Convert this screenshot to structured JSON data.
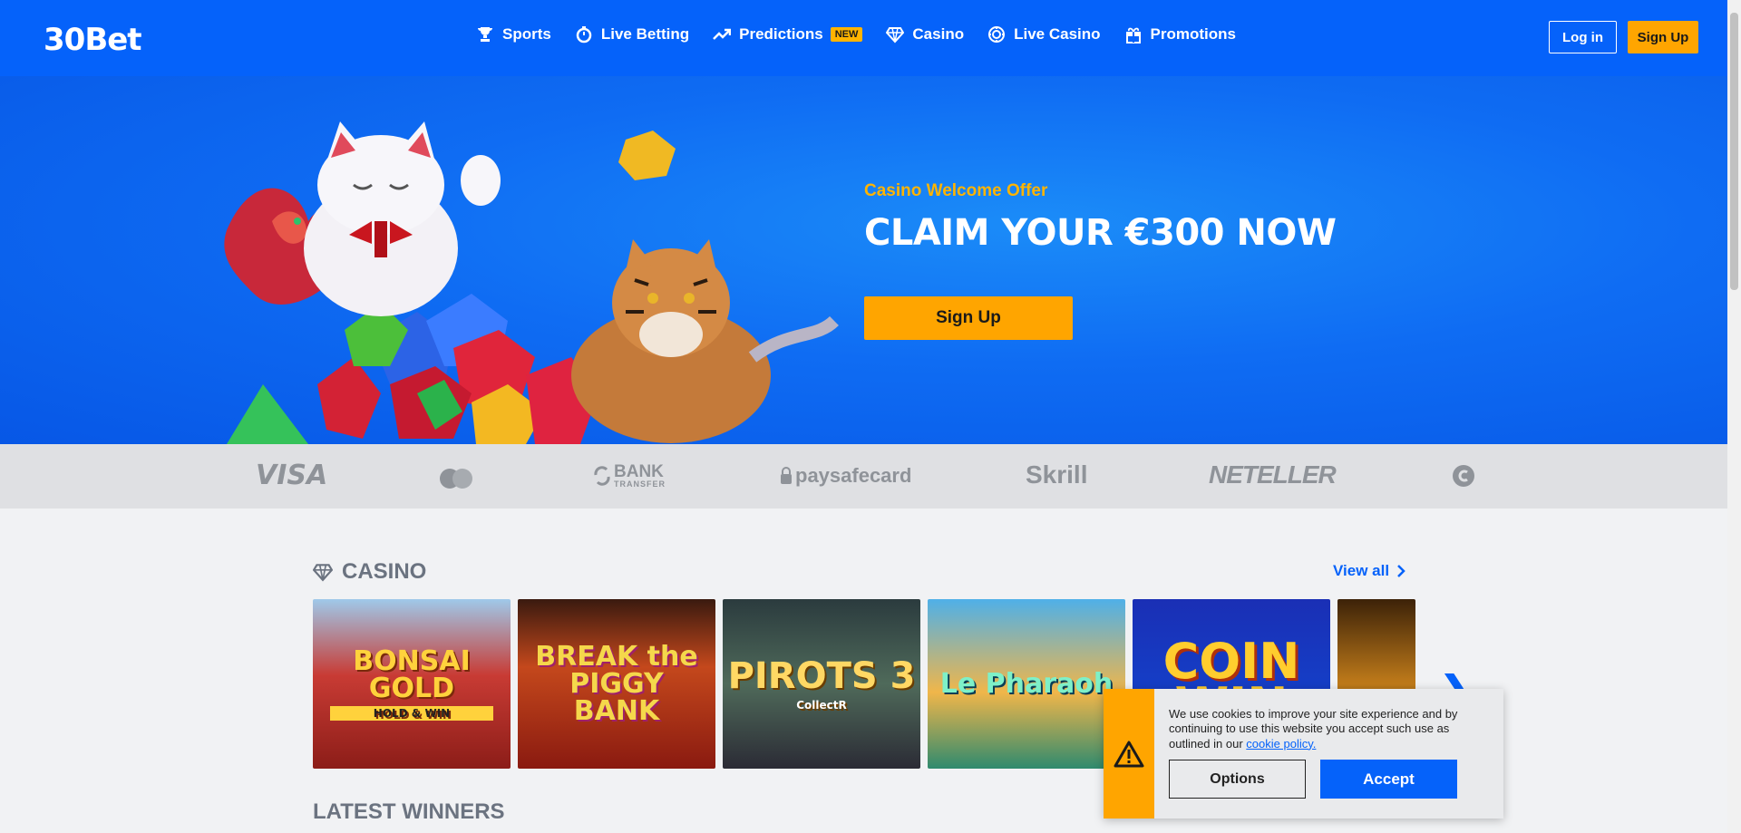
{
  "header": {
    "logo": "30Bet",
    "nav": [
      {
        "label": "Sports",
        "icon": "trophy-icon"
      },
      {
        "label": "Live Betting",
        "icon": "stopwatch-icon"
      },
      {
        "label": "Predictions",
        "icon": "trend-up-icon",
        "badge": "NEW"
      },
      {
        "label": "Casino",
        "icon": "diamond-icon"
      },
      {
        "label": "Live Casino",
        "icon": "chip-icon"
      },
      {
        "label": "Promotions",
        "icon": "gift-icon"
      }
    ],
    "login_label": "Log in",
    "signup_label": "Sign Up"
  },
  "hero": {
    "subtitle": "Casino Welcome Offer",
    "title": "CLAIM YOUR €300 NOW",
    "button_label": "Sign Up"
  },
  "payments": [
    "VISA",
    "mastercard",
    "BANK TRANSFER",
    "paysafecard",
    "Skrill",
    "NETELLER",
    "crypto"
  ],
  "casino": {
    "title": "CASINO",
    "view_all": "View all",
    "games": [
      {
        "title": "BONSAI GOLD",
        "sub": "HOLD & WIN"
      },
      {
        "title": "BREAK the PIGGY BANK",
        "sub": ""
      },
      {
        "title": "PIROTS 3",
        "sub": "CollectR"
      },
      {
        "title": "Le Pharaoh",
        "sub": ""
      },
      {
        "title": "COIN WIN",
        "sub": ""
      },
      {
        "title": "",
        "sub": ""
      }
    ]
  },
  "latest_winners": "LATEST WINNERS",
  "cookie": {
    "text": "We use cookies to improve your site experience and by continuing to use this website you accept such use as outlined in our",
    "link": "cookie policy.",
    "options_label": "Options",
    "accept_label": "Accept"
  },
  "colors": {
    "brand_blue": "#0562fa",
    "accent_orange": "#ffa500",
    "background": "#f1f2f4"
  }
}
